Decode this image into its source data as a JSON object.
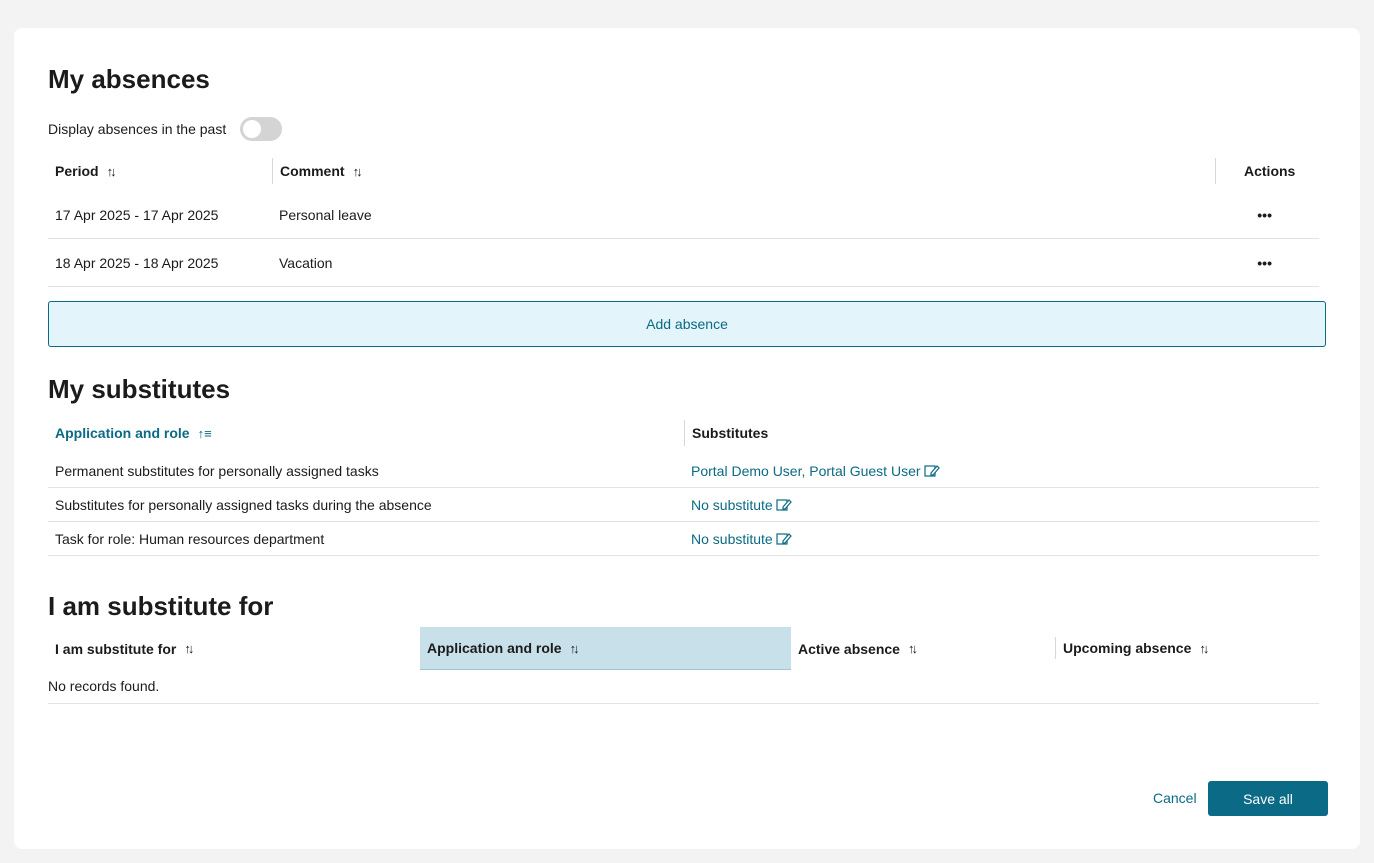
{
  "absences": {
    "title": "My absences",
    "toggle_label": "Display absences in the past",
    "toggle_on": false,
    "columns": {
      "period": "Period",
      "comment": "Comment",
      "actions": "Actions"
    },
    "rows": [
      {
        "period": "17 Apr 2025 - 17 Apr 2025",
        "comment": "Personal leave",
        "actions": "•••"
      },
      {
        "period": "18 Apr 2025 - 18 Apr 2025",
        "comment": "Vacation",
        "actions": "•••"
      }
    ],
    "add_label": "Add absence"
  },
  "substitutes": {
    "title": "My substitutes",
    "columns": {
      "app_role": "Application and role",
      "substitutes": "Substitutes"
    },
    "rows": [
      {
        "app_role": "Permanent substitutes for personally assigned tasks",
        "substitutes": "Portal Demo User, Portal Guest User"
      },
      {
        "app_role": "Substitutes for personally assigned tasks during the absence",
        "substitutes": "No substitute"
      },
      {
        "app_role": "Task for role: Human resources department",
        "substitutes": "No substitute"
      }
    ]
  },
  "substitute_for": {
    "title": "I am substitute for",
    "columns": {
      "for": "I am substitute for",
      "app_role": "Application and role",
      "active": "Active absence",
      "upcoming": "Upcoming absence"
    },
    "empty": "No records found."
  },
  "footer": {
    "cancel": "Cancel",
    "save": "Save all"
  },
  "colors": {
    "accent": "#0b6a85",
    "add_bg": "#e3f4fa",
    "highlight": "#c8e0e9"
  }
}
